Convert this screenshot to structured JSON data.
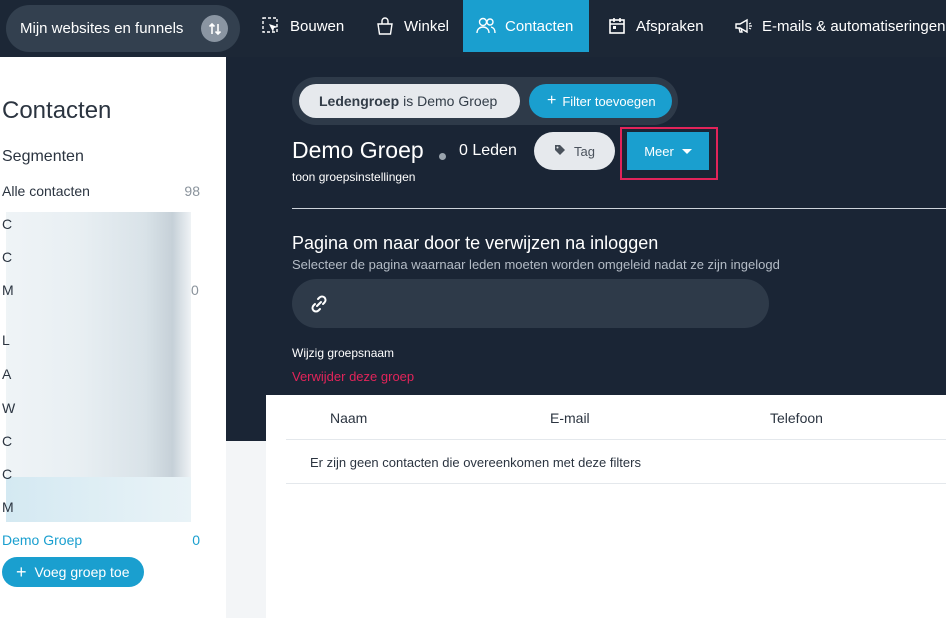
{
  "topnav": {
    "site_switcher": "Mijn websites en funnels",
    "items": [
      {
        "label": "Bouwen",
        "icon": "build-icon"
      },
      {
        "label": "Winkel",
        "icon": "shop-bag-icon"
      },
      {
        "label": "Contacten",
        "icon": "contacts-icon",
        "active": true
      },
      {
        "label": "Afspraken",
        "icon": "calendar-icon"
      },
      {
        "label": "E-mails & automatiseringen",
        "icon": "megaphone-icon"
      }
    ]
  },
  "sidebar": {
    "title": "Contacten",
    "segments_heading": "Segmenten",
    "all_contacts": {
      "label": "Alle contacten",
      "count": "98"
    },
    "partial_count": "0",
    "stubs": [
      "C",
      "C",
      "M",
      "L",
      "A",
      "W",
      "C",
      "C",
      "M"
    ],
    "active_group": {
      "label": "Demo Groep",
      "count": "0"
    },
    "add_group_label": "Voeg groep toe"
  },
  "filter": {
    "chip_key": "Ledengroep",
    "chip_rest": "is Demo Groep",
    "add_filter_label": "Filter toevoegen"
  },
  "group": {
    "title": "Demo Groep",
    "members": "0 Leden",
    "settings_link": "toon groepsinstellingen",
    "tag_label": "Tag",
    "more_label": "Meer"
  },
  "redirect": {
    "title": "Pagina om naar door te verwijzen na inloggen",
    "subtitle": "Selecteer de pagina waarnaar leden moeten worden omgeleid nadat ze zijn ingelogd",
    "rename_label": "Wijzig groepsnaam",
    "delete_label": "Verwijder deze groep"
  },
  "table": {
    "columns": [
      "Naam",
      "E-mail",
      "Telefoon"
    ],
    "empty_message": "Er zijn geen contacten die overeenkomen met deze filters"
  },
  "colors": {
    "accent": "#1a9fcf",
    "danger": "#e2245a",
    "dark_bg": "#1a2535"
  }
}
